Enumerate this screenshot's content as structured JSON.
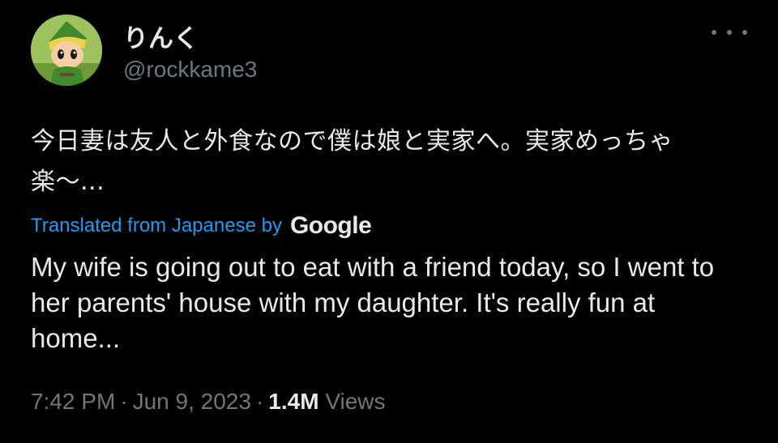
{
  "tweet": {
    "display_name": "りんく",
    "handle": "@rockkame3",
    "more_icon": "more-horizontal-icon",
    "original_text": "今日妻は友人と外食なので僕は娘と実家へ。実家めっちゃ楽〜...",
    "translated_label": "Translated from Japanese by",
    "translated_brand": "Google",
    "translation": "My wife is going out to eat with a friend today, so I went to her parents' house with my daughter. It's really fun at home...",
    "time": "7:42 PM",
    "separator": "·",
    "date": "Jun 9, 2023",
    "views_count": "1.4M",
    "views_label": "Views"
  },
  "colors": {
    "background": "#000000",
    "text_primary": "#e7e9ea",
    "text_secondary": "#71767b",
    "link": "#1d9bf0"
  }
}
